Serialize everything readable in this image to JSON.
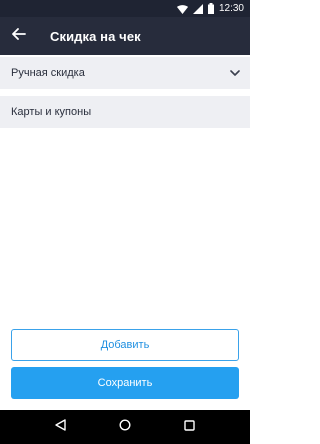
{
  "status_bar": {
    "time": "12:30",
    "icons": [
      "wifi-icon",
      "cellular-icon",
      "battery-icon"
    ]
  },
  "app_bar": {
    "title": "Скидка на чек",
    "back_icon": "arrow-left-icon"
  },
  "sections": {
    "manual_discount": {
      "label": "Ручная скидка",
      "icon": "chevron-down-icon"
    },
    "cards_coupons": {
      "label": "Карты и купоны"
    }
  },
  "buttons": {
    "add_label": "Добавить",
    "save_label": "Сохранить"
  },
  "nav_bar": {
    "icons": [
      "back-triangle-icon",
      "home-circle-icon",
      "recents-square-icon"
    ]
  },
  "colors": {
    "app_bar": "#272c3c",
    "status_bar": "#1f2433",
    "section_bg": "#eeeff3",
    "accent": "#25a0f0"
  }
}
